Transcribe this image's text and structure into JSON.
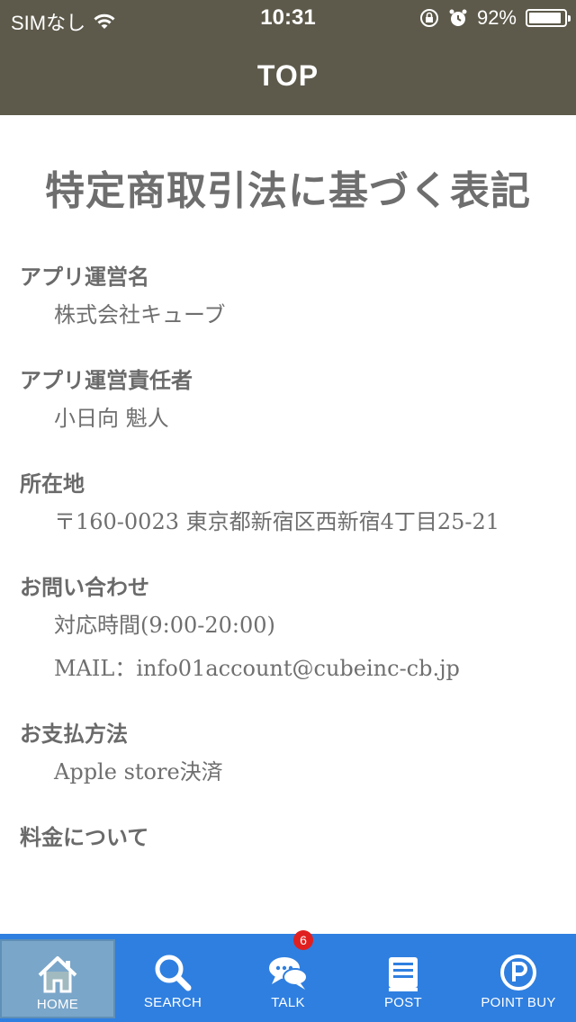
{
  "status_bar": {
    "carrier": "SIMなし",
    "time": "10:31",
    "battery_text": "92%",
    "battery_level": 0.92
  },
  "nav": {
    "title": "TOP"
  },
  "page": {
    "title": "特定商取引法に基づく表記",
    "sections": [
      {
        "heading": "アプリ運営名",
        "lines": [
          "株式会社キューブ"
        ]
      },
      {
        "heading": "アプリ運営責任者",
        "lines": [
          "小日向 魁人"
        ]
      },
      {
        "heading": "所在地",
        "lines": [
          "〒160-0023 東京都新宿区西新宿4丁目25-21"
        ]
      },
      {
        "heading": "お問い合わせ",
        "lines": [
          "対応時間(9:00-20:00)",
          "MAIL：info01account@cubeinc-cb.jp"
        ]
      },
      {
        "heading": "お支払方法",
        "lines": [
          "Apple store決済"
        ]
      },
      {
        "heading": "料金について",
        "lines": []
      }
    ]
  },
  "tabs": [
    {
      "label": "HOME",
      "icon": "home-icon",
      "active": true
    },
    {
      "label": "SEARCH",
      "icon": "search-icon"
    },
    {
      "label": "TALK",
      "icon": "talk-icon",
      "badge": "6"
    },
    {
      "label": "POST",
      "icon": "post-icon"
    },
    {
      "label": "POINT BUY",
      "icon": "point-buy-icon"
    }
  ],
  "colors": {
    "header": "#5d5a4b",
    "tab_bar": "#2f7fe0",
    "active_tab": "#7aa6c9",
    "badge": "#e02020"
  }
}
